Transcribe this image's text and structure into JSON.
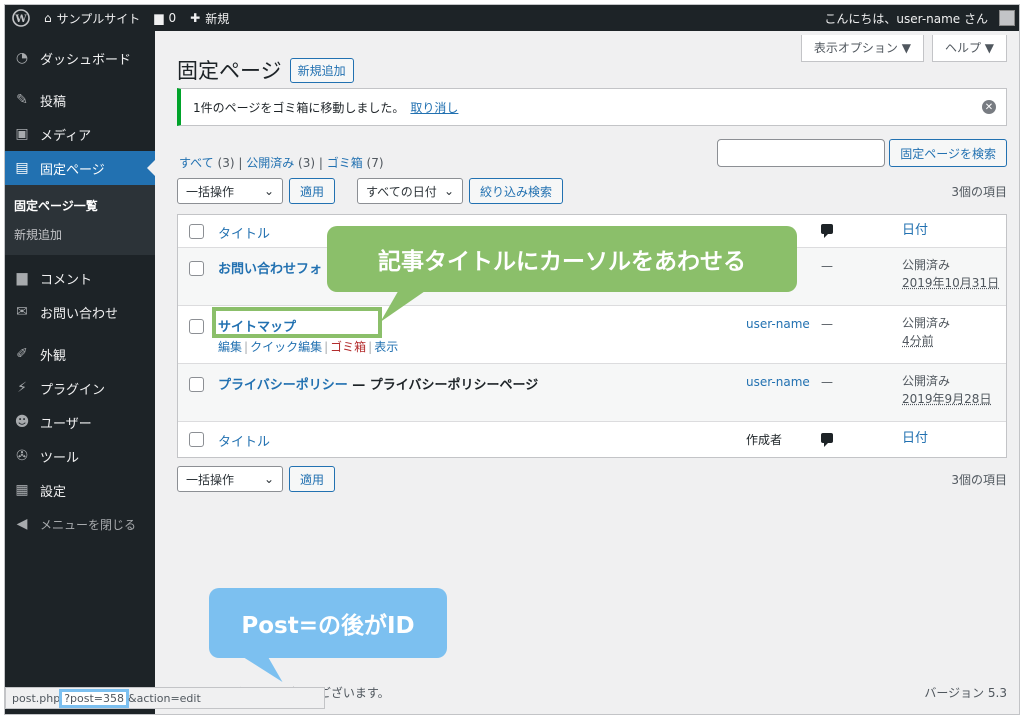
{
  "adminbar": {
    "site_name": "サンプルサイト",
    "comments_count": "0",
    "new_label": "新規",
    "greeting": "こんにちは、user-name さん"
  },
  "sidebar": {
    "items": [
      {
        "label": "ダッシュボード",
        "icon": "dashboard-icon"
      },
      {
        "label": "投稿",
        "icon": "pin-icon"
      },
      {
        "label": "メディア",
        "icon": "media-icon"
      },
      {
        "label": "固定ページ",
        "icon": "page-icon"
      },
      {
        "label": "コメント",
        "icon": "comment-icon"
      },
      {
        "label": "お問い合わせ",
        "icon": "mail-icon"
      },
      {
        "label": "外観",
        "icon": "brush-icon"
      },
      {
        "label": "プラグイン",
        "icon": "plugin-icon"
      },
      {
        "label": "ユーザー",
        "icon": "user-icon"
      },
      {
        "label": "ツール",
        "icon": "wrench-icon"
      },
      {
        "label": "設定",
        "icon": "settings-icon"
      }
    ],
    "submenu": [
      "固定ページ一覧",
      "新規追加"
    ],
    "collapse_label": "メニューを閉じる"
  },
  "screen_meta": {
    "options": "表示オプション ▼",
    "help": "ヘルプ ▼"
  },
  "page": {
    "title": "固定ページ",
    "add_new": "新規追加"
  },
  "notice": {
    "text": "1件のページをゴミ箱に移動しました。",
    "undo": "取り消し"
  },
  "filters": {
    "all": "すべて",
    "all_count": "(3)",
    "published": "公開済み",
    "published_count": "(3)",
    "trash": "ゴミ箱",
    "trash_count": "(7)"
  },
  "search": {
    "button": "固定ページを検索",
    "value": ""
  },
  "tablenav": {
    "bulk": "一括操作",
    "apply": "適用",
    "dates": "すべての日付",
    "filter": "絞り込み検索",
    "count": "3個の項目"
  },
  "table": {
    "header": {
      "title": "タイトル",
      "author": "作成者",
      "date": "日付"
    },
    "rows": [
      {
        "title": "お問い合わせフォ",
        "subtitle": "",
        "author": "user-name",
        "comments": "—",
        "status": "公開済み",
        "date": "2019年10月31日"
      },
      {
        "title": "サイトマップ",
        "subtitle": "",
        "author": "user-name",
        "comments": "—",
        "status": "公開済み",
        "date": "4分前"
      },
      {
        "title": "プライバシーポリシー",
        "subtitle": " — プライバシーポリシーページ",
        "author": "user-name",
        "comments": "—",
        "status": "公開済み",
        "date": "2019年9月28日"
      }
    ],
    "row_actions": {
      "edit": "編集",
      "quick_edit": "クイック編集",
      "trash": "ゴミ箱",
      "view": "表示"
    },
    "row2_author_partial": "ne"
  },
  "footer": {
    "thanks": "W　　　　利用ありがとうございます。",
    "version": "バージョン 5.3"
  },
  "statusbar": {
    "prefix": "post.php",
    "highlight": "?post=358",
    "suffix": "&action=edit"
  },
  "callouts": {
    "green": "記事タイトルにカーソルをあわせる",
    "blue": "Post=の後がID"
  },
  "colors": {
    "accent": "#2271b1",
    "sidebar": "#1d2327",
    "callout_green": "#8bbf6a",
    "callout_blue": "#7cc0f0"
  }
}
